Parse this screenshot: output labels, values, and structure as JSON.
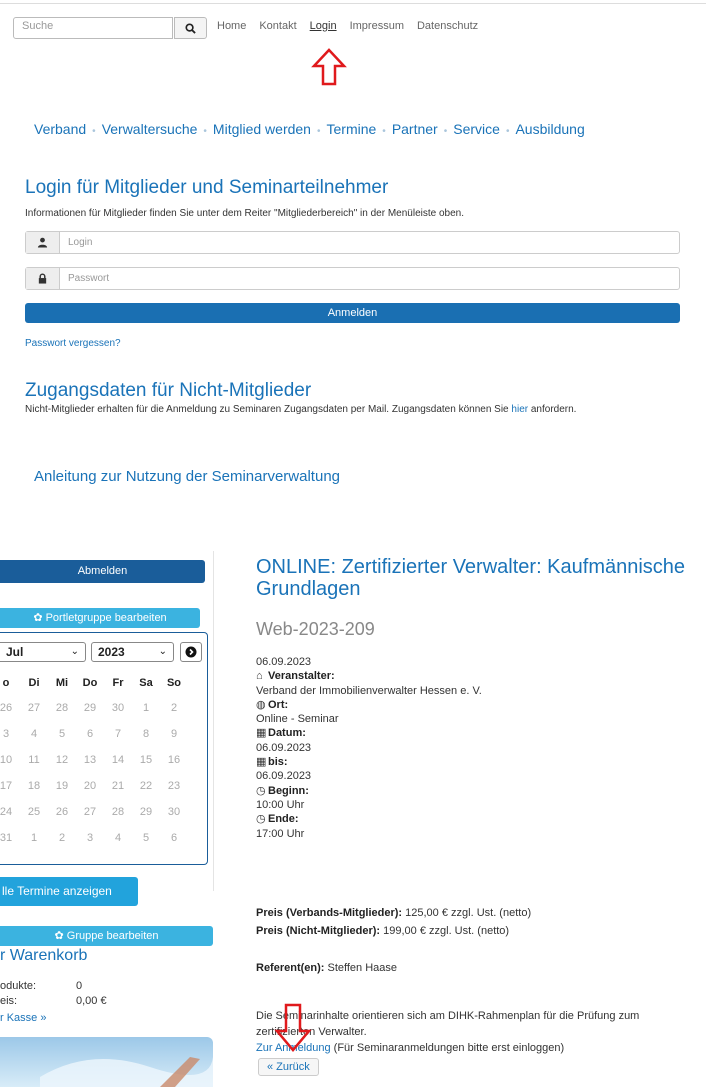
{
  "search": {
    "placeholder": "Suche"
  },
  "topnav": [
    "Home",
    "Kontakt",
    "Login",
    "Impressum",
    "Datenschutz"
  ],
  "mainnav": [
    "Verband",
    "Verwaltersuche",
    "Mitglied werden",
    "Termine",
    "Partner",
    "Service",
    "Ausbildung"
  ],
  "login": {
    "title": "Login für Mitglieder und Seminarteilnehmer",
    "info": "Informationen für Mitglieder finden Sie unter dem Reiter \"Mitgliederbereich\" in der Menüleiste oben.",
    "login_placeholder": "Login",
    "password_placeholder": "Passwort",
    "submit_label": "Anmelden",
    "forgot_label": "Passwort vergessen?"
  },
  "nonmember": {
    "title": "Zugangsdaten für Nicht-Mitglieder",
    "text_before": "Nicht-Mitglieder erhalten für die Anmeldung zu Seminaren Zugangsdaten per Mail. Zugangsdaten können Sie ",
    "link": "hier",
    "text_after": " anfordern."
  },
  "guide_link": "Anleitung zur Nutzung der Seminarverwaltung",
  "sidebar": {
    "logout_label": "Abmelden",
    "portlet_label": "Portletgruppe bearbeiten",
    "calendar": {
      "month": "Jul",
      "year": "2023",
      "weekdays": [
        "o",
        "Di",
        "Mi",
        "Do",
        "Fr",
        "Sa",
        "So"
      ],
      "weeks": [
        [
          "26",
          "27",
          "28",
          "29",
          "30",
          "1",
          "2"
        ],
        [
          "3",
          "4",
          "5",
          "6",
          "7",
          "8",
          "9"
        ],
        [
          "10",
          "11",
          "12",
          "13",
          "14",
          "15",
          "16"
        ],
        [
          "17",
          "18",
          "19",
          "20",
          "21",
          "22",
          "23"
        ],
        [
          "24",
          "25",
          "26",
          "27",
          "28",
          "29",
          "30"
        ],
        [
          "31",
          "1",
          "2",
          "3",
          "4",
          "5",
          "6"
        ]
      ]
    },
    "all_events_label": "lle Termine anzeigen",
    "group_label": "Gruppe bearbeiten",
    "cart_title": "r Warenkorb",
    "cart_products_label": "odukte:",
    "cart_products_value": "0",
    "cart_price_label": "eis:",
    "cart_price_value": "0,00 €",
    "checkout_label": "r Kasse »"
  },
  "event": {
    "title": "ONLINE: Zertifizierter Verwalter: Kaufmännische Grundlagen",
    "code": "Web-2023-209",
    "date": "06.09.2023",
    "organizer_label": "Veranstalter:",
    "organizer": "Verband der Immobilienverwalter Hessen e. V.",
    "location_label": "Ort:",
    "location": "Online - Seminar",
    "date_label": "Datum:",
    "date_value": "06.09.2023",
    "until_label": "bis:",
    "until_value": "06.09.2023",
    "start_label": "Beginn:",
    "start_value": "10:00 Uhr",
    "end_label": "Ende:",
    "end_value": "17:00 Uhr",
    "price_member_label": "Preis (Verbands-Mitglieder):",
    "price_member": " 125,00 € zzgl. Ust. (netto)",
    "price_nonmember_label": "Preis (Nicht-Mitglieder):",
    "price_nonmember": " 199,00 € zzgl. Ust. (netto)",
    "speaker_label": "Referent(en):",
    "speaker": " Steffen Haase",
    "description": "Die Seminarinhalte orientieren sich am DIHK-Rahmenplan für die Prüfung zum zertifizierten Verwalter.",
    "register_link": "Zur Anmeldung",
    "register_note": " (Für Seminaranmeldungen bitte erst einloggen)",
    "back_label": "« Zurück"
  },
  "colors": {
    "link": "#1a73b8",
    "button": "#1a6fb2",
    "button_light": "#3bb3e0",
    "annotation_arrow": "#e0191c"
  }
}
